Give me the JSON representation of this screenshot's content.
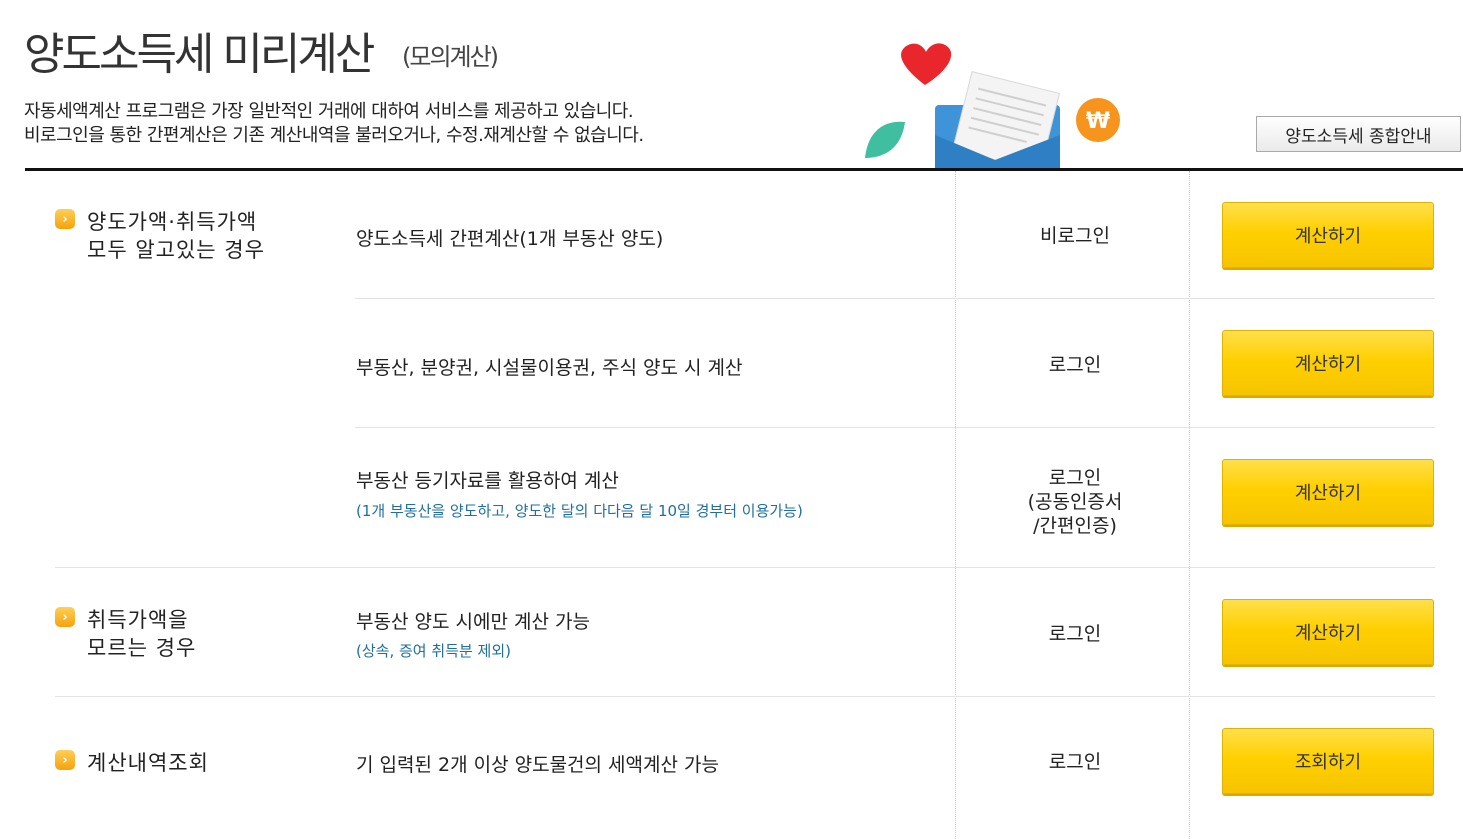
{
  "header": {
    "title": "양도소득세 미리계산",
    "subtitle": "(모의계산)",
    "desc_line1": "자동세액계산 프로그램은 가장 일반적인 거래에 대하여 서비스를 제공하고 있습니다.",
    "desc_line2": "비로그인을 통한 간편계산은 기존 계산내역을 불러오거나, 수정.재계산할 수 없습니다.",
    "guide_button": "양도소득세 종합안내"
  },
  "categories": [
    {
      "label": "양도가액·취득가액\n모두 알고있는 경우",
      "bullet": "›"
    },
    {
      "label": "취득가액을\n모르는 경우",
      "bullet": "›"
    },
    {
      "label": "계산내역조회",
      "bullet": "›"
    }
  ],
  "rows": [
    {
      "service": "양도소득세 간편계산(1개 부동산 양도)",
      "note": "",
      "login": "비로그인",
      "button": "계산하기"
    },
    {
      "service": "부동산, 분양권, 시설물이용권, 주식 양도 시 계산",
      "note": "",
      "login": "로그인",
      "button": "계산하기"
    },
    {
      "service": "부동산 등기자료를 활용하여 계산",
      "note": "(1개 부동산을 양도하고, 양도한 달의 다다음 달 10일 경부터 이용가능)",
      "login": "로그인\n(공동인증서\n/간편인증)",
      "button": "계산하기"
    },
    {
      "service": "부동산 양도 시에만 계산 가능",
      "note": "(상속, 증여 취득분 제외)",
      "login": "로그인",
      "button": "계산하기"
    },
    {
      "service": "기 입력된 2개 이상 양도물건의 세액계산 가능",
      "note": "",
      "login": "로그인",
      "button": "조회하기"
    }
  ],
  "illustration": {
    "heart_color": "#e8262b",
    "envelope_color": "#3f93d9",
    "coin_color": "#f7941d",
    "coin_symbol": "₩",
    "leaf_color": "#3fbfa0"
  }
}
